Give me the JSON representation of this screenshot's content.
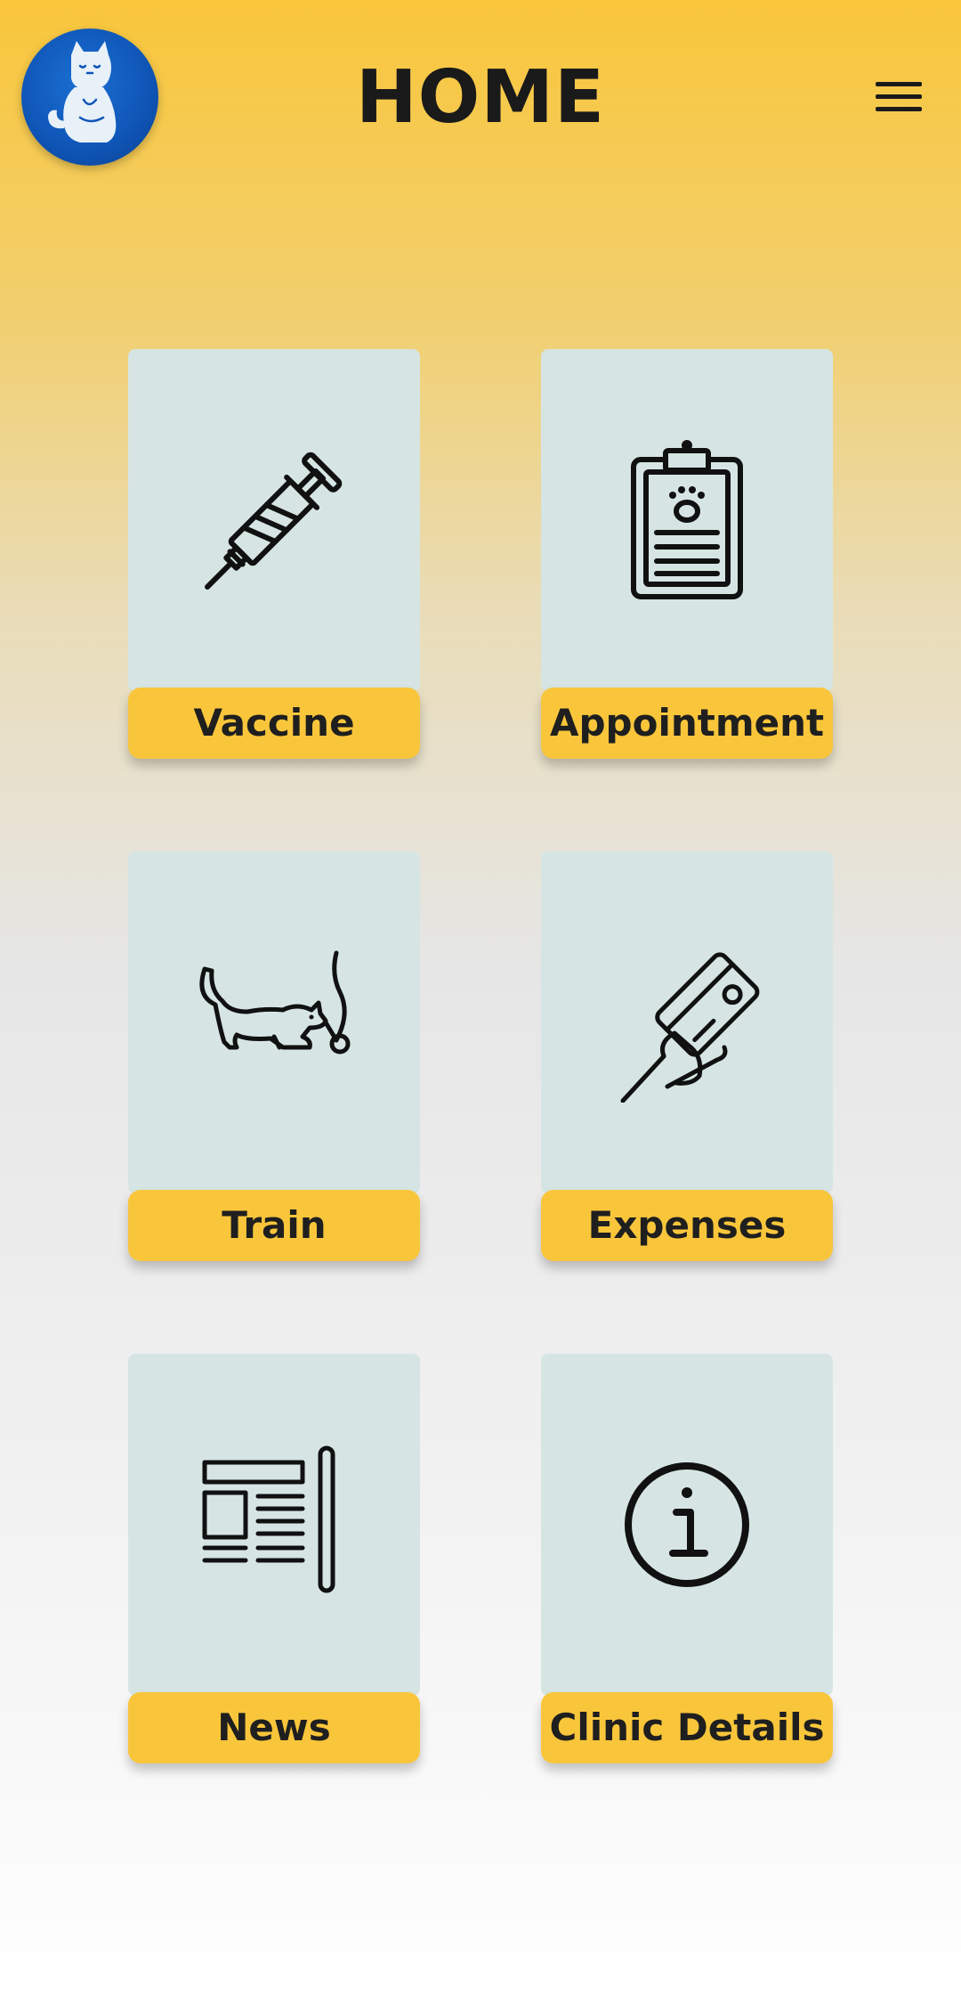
{
  "header": {
    "title": "HOME",
    "logo_icon": "cat-logo-icon",
    "menu_icon": "hamburger-menu-icon"
  },
  "tiles": [
    {
      "label": "Vaccine",
      "icon": "syringe-icon"
    },
    {
      "label": "Appointment",
      "icon": "clipboard-paw-icon"
    },
    {
      "label": "Train",
      "icon": "cat-playing-icon"
    },
    {
      "label": "Expenses",
      "icon": "card-payment-icon"
    },
    {
      "label": "News",
      "icon": "newspaper-icon"
    },
    {
      "label": "Clinic Details",
      "icon": "info-icon"
    }
  ],
  "colors": {
    "accent": "#f9c63b",
    "card": "#d6e5e3",
    "logo": "#0f55b6",
    "text": "#1a1a1a"
  }
}
